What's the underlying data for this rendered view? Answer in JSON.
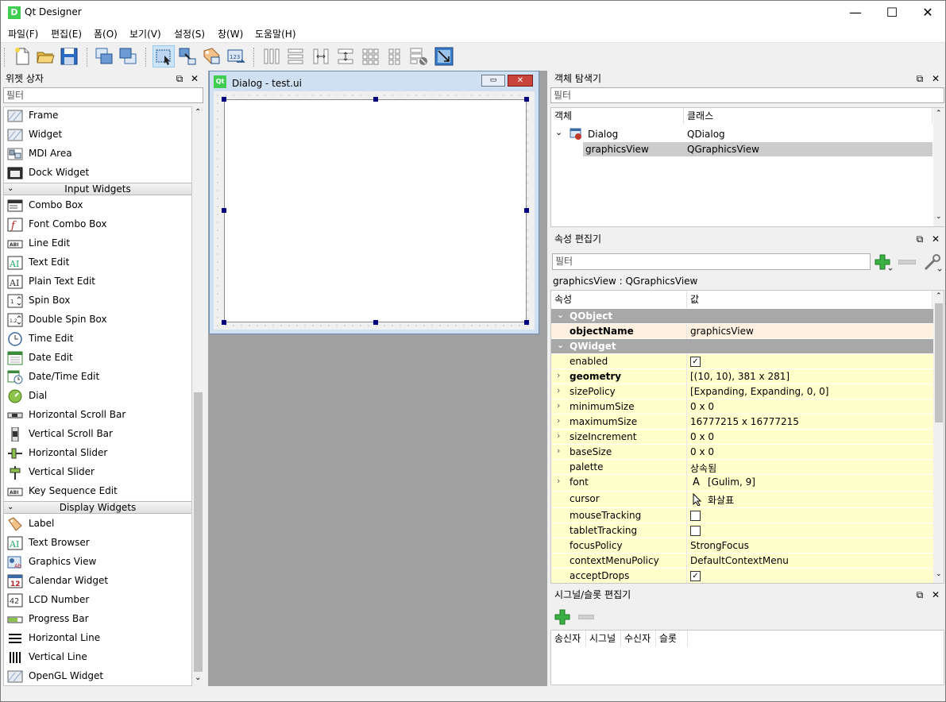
{
  "app": {
    "title": "Qt Designer",
    "icon_letter": "D"
  },
  "window_controls": {
    "minimize": "—",
    "maximize": "☐",
    "close": "✕"
  },
  "menu": [
    "파일(F)",
    "편집(E)",
    "폼(O)",
    "보기(V)",
    "설정(S)",
    "창(W)",
    "도움말(H)"
  ],
  "toolbar_icons": [
    "new-form-icon",
    "open-form-icon",
    "save-form-icon",
    "send-to-back-icon",
    "bring-to-front-icon",
    "edit-widgets-icon",
    "edit-signals-slots-icon",
    "edit-buddies-icon",
    "edit-tab-order-icon",
    "layout-horizontal-icon",
    "layout-vertical-icon",
    "layout-h-splitter-icon",
    "layout-v-splitter-icon",
    "layout-grid-icon",
    "layout-form-icon",
    "break-layout-icon",
    "adjust-size-icon"
  ],
  "widget_box": {
    "title": "위젯 상자",
    "filter_placeholder": "필터",
    "items_top": [
      "Frame",
      "Widget",
      "MDI Area",
      "Dock Widget"
    ],
    "cat_input": "Input Widgets",
    "items_input": [
      "Combo Box",
      "Font Combo Box",
      "Line Edit",
      "Text Edit",
      "Plain Text Edit",
      "Spin Box",
      "Double Spin Box",
      "Time Edit",
      "Date Edit",
      "Date/Time Edit",
      "Dial",
      "Horizontal Scroll Bar",
      "Vertical Scroll Bar",
      "Horizontal Slider",
      "Vertical Slider",
      "Key Sequence Edit"
    ],
    "cat_display": "Display Widgets",
    "items_display": [
      "Label",
      "Text Browser",
      "Graphics View",
      "Calendar Widget",
      "LCD Number",
      "Progress Bar",
      "Horizontal Line",
      "Vertical Line",
      "OpenGL Widget"
    ]
  },
  "dialog": {
    "icon": "Qt",
    "title": "Dialog - test.ui",
    "min": "▭",
    "close": "✕"
  },
  "object_inspector": {
    "title": "객체 탐색기",
    "filter_placeholder": "필터",
    "col_object": "객체",
    "col_class": "클래스",
    "rows": [
      {
        "object": "Dialog",
        "class": "QDialog"
      },
      {
        "object": "graphicsView",
        "class": "QGraphicsView"
      }
    ]
  },
  "property_editor": {
    "title": "속성 편집기",
    "filter_placeholder": "필터",
    "selected": "graphicsView : QGraphicsView",
    "col_property": "속성",
    "col_value": "값",
    "group_qobject": "QObject",
    "group_qwidget": "QWidget",
    "props": [
      {
        "name": "objectName",
        "value": "graphicsView"
      },
      {
        "name": "enabled",
        "value": "✓"
      },
      {
        "name": "geometry",
        "value": "[(10, 10), 381 x 281]"
      },
      {
        "name": "sizePolicy",
        "value": "[Expanding, Expanding, 0, 0]"
      },
      {
        "name": "minimumSize",
        "value": "0 x 0"
      },
      {
        "name": "maximumSize",
        "value": "16777215 x 16777215"
      },
      {
        "name": "sizeIncrement",
        "value": "0 x 0"
      },
      {
        "name": "baseSize",
        "value": "0 x 0"
      },
      {
        "name": "palette",
        "value": "상속됨"
      },
      {
        "name": "font",
        "value": "[Gulim, 9]"
      },
      {
        "name": "cursor",
        "value": "화살표"
      },
      {
        "name": "mouseTracking",
        "value": ""
      },
      {
        "name": "tabletTracking",
        "value": ""
      },
      {
        "name": "focusPolicy",
        "value": "StrongFocus"
      },
      {
        "name": "contextMenuPolicy",
        "value": "DefaultContextMenu"
      },
      {
        "name": "acceptDrops",
        "value": "✓"
      }
    ]
  },
  "signal_slot_editor": {
    "title": "시그널/슬롯 편집기",
    "cols": [
      "송신자",
      "시그널",
      "수신자",
      "슬롯"
    ]
  },
  "colors": {
    "accent": "#41cd52",
    "selection": "#cccccc",
    "group_header": "#a8a8a8",
    "prop_yellow": "#ffffcc",
    "prop_orange": "#fff0e0"
  }
}
